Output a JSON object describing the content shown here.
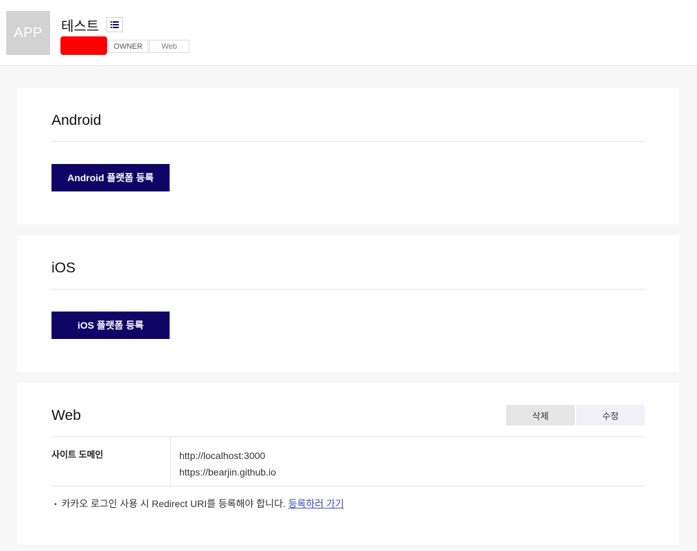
{
  "header": {
    "thumbnail_text": "APP",
    "app_name": "테스트",
    "list_icon": "list-icon",
    "tags": [
      "OWNER",
      "Web"
    ]
  },
  "android": {
    "title": "Android",
    "register_button": "Android 플랫폼 등록"
  },
  "ios": {
    "title": "iOS",
    "register_button": "iOS 플랫폼 등록"
  },
  "web": {
    "title": "Web",
    "delete_button": "삭제",
    "edit_button": "수정",
    "domain_label": "사이트 도메인",
    "domains": [
      "http://localhost:3000",
      "https://bearjin.github.io"
    ],
    "notice_text": "카카오 로그인 사용 시 Redirect URI를 등록해야 합니다.",
    "notice_link": "등록하러 가기"
  },
  "colors": {
    "primary": "#0f0566",
    "redacted": "#ff0000",
    "link": "#3a48c9"
  }
}
